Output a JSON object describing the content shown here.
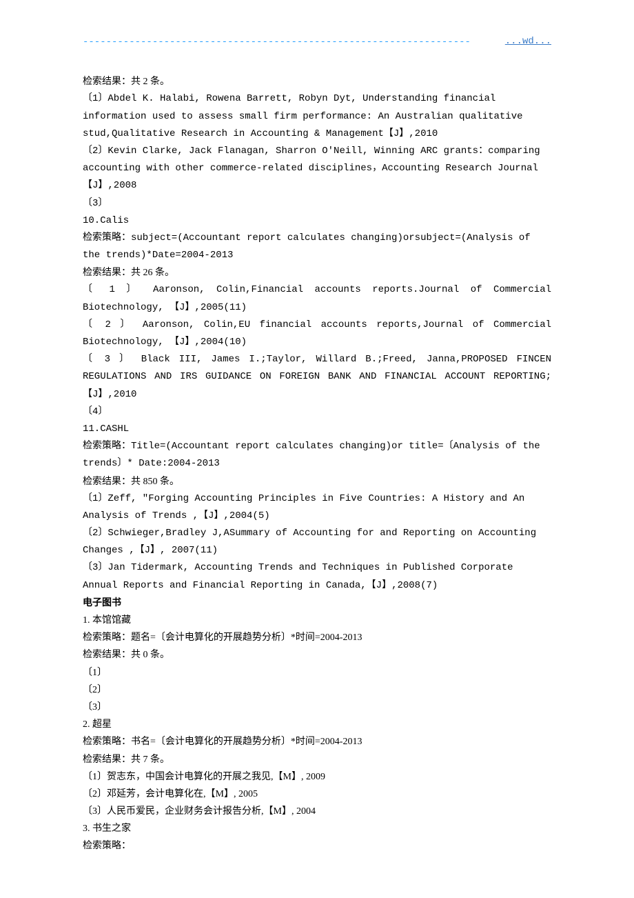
{
  "header": {
    "wd": "...wd...",
    "dashes": "-------------------------------------------------------------------"
  },
  "block9": {
    "result_label": "检索结果：共 2 条。",
    "items": [
      "〔1〕Abdel K. Halabi, Rowena Barrett, Robyn Dyt, Understanding financial information used to assess small firm performance: An Australian qualitative stud,Qualitative Research in Accounting & Management【J】,2010",
      "〔2〕Kevin Clarke, Jack Flanagan, Sharron O'Neill,  Winning ARC grants：comparing accounting with other commerce-related disciplines，Accounting Research Journal【J】,2008",
      "〔3〕"
    ]
  },
  "block10": {
    "title": "10.Calis",
    "strategy_label": "检索策略：subject=(Accountant report calculates changing)orsubject=(Analysis of the trends)*Date=2004-2013",
    "result_label": "检索结果：共 26 条。",
    "items": [
      "〔 1 〕 Aaronson,  Colin,Financial  accounts  reports.Journal  of  Commercial Biotechnology, 【J】,2005(11)",
      "〔 2 〕 Aaronson,  Colin,EU  financial  accounts  reports,Journal  of  Commercial Biotechnology, 【J】,2004(10)",
      "〔 3 〕 Black  III,  James  I.;Taylor,  Willard  B.;Freed,  Janna,PROPOSED  FINCEN REGULATIONS AND IRS GUIDANCE ON FOREIGN BANK AND FINANCIAL ACCOUNT REPORTING;【J】,2010",
      "〔4〕"
    ]
  },
  "block11": {
    "title": "11.CASHL",
    "strategy_label": "检索策略：Title=(Accountant report calculates changing)or title=〔Analysis of the trends〕* Date:2004-2013",
    "result_label": "检索结果：共 850 条。",
    "items": [
      "〔1〕Zeff, \"Forging Accounting Principles in Five Countries: A History and An Analysis of Trends ,【J】,2004(5)",
      "〔2〕Schwieger,Bradley J,ASummary of Accounting for and Reporting on Accounting Changes ,【J】, 2007(11)",
      "〔3〕Jan Tidermark, Accounting Trends and Techniques in Published Corporate Annual Reports and Financial Reporting in Canada,【J】,2008(7)"
    ]
  },
  "ebook": {
    "section_title": "电子图书",
    "sub1": {
      "title": "1.  本馆馆藏",
      "strategy": "检索策略：题名=〔会计电算化的开展趋势分析〕*时间=2004-2013",
      "result": "检索结果：共 0 条。",
      "items": [
        "〔1〕",
        "〔2〕",
        "〔3〕"
      ]
    },
    "sub2": {
      "title": "2.  超星",
      "strategy": "检索策略：书名=〔会计电算化的开展趋势分析〕*时间=2004-2013",
      "result": "检索结果：共 7 条。",
      "items": [
        "〔1〕贺志东，中国会计电算化的开展之我见,【M】, 2009",
        "〔2〕邓延芳，会计电算化在,【M】, 2005",
        "〔3〕人民币爱民，企业财务会计报告分析,【M】, 2004"
      ]
    },
    "sub3": {
      "title": "3.  书生之家",
      "strategy": "检索策略："
    }
  }
}
